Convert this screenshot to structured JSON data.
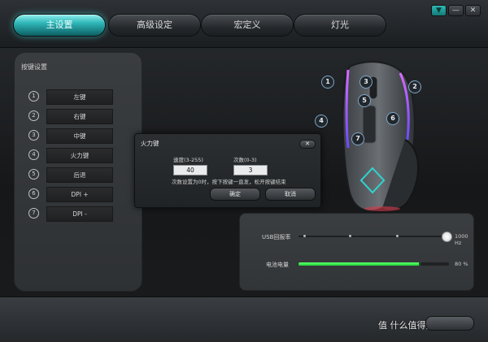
{
  "window_controls": {
    "minimize_label": "▼",
    "restore_label": "—",
    "close_label": "✕"
  },
  "tabs": [
    {
      "label": "主设置",
      "active": true
    },
    {
      "label": "高级设定",
      "active": false
    },
    {
      "label": "宏定义",
      "active": false
    },
    {
      "label": "灯光",
      "active": false
    }
  ],
  "key_settings": {
    "title": "按键设置",
    "items": [
      {
        "num": "1",
        "label": "左键"
      },
      {
        "num": "2",
        "label": "右键"
      },
      {
        "num": "3",
        "label": "中键"
      },
      {
        "num": "4",
        "label": "火力键"
      },
      {
        "num": "5",
        "label": "后退"
      },
      {
        "num": "6",
        "label": "DPI +"
      },
      {
        "num": "7",
        "label": "DPI -"
      }
    ]
  },
  "mouse_callouts": [
    "1",
    "2",
    "3",
    "4",
    "5",
    "6",
    "7"
  ],
  "settings": {
    "usb_label": "USB回报率",
    "usb_value": "1000 Hz",
    "usb_level": 1.0,
    "battery_label": "电池电量",
    "battery_value": "80 %",
    "battery_level": 0.8
  },
  "dialog": {
    "title": "火力键",
    "close_label": "✕",
    "speed_label": "速度(3-255)",
    "speed_value": "40",
    "count_label": "次数(0-3)",
    "count_value": "3",
    "hint": "次数设置为0时，按下按键一直发，松开按键结束",
    "ok_label": "确定",
    "cancel_label": "取消"
  },
  "watermark": "值 什么值得买",
  "colors": {
    "accent": "#2fb6b8",
    "battery": "#2dff4a",
    "mouse_led": "#e04cff"
  }
}
